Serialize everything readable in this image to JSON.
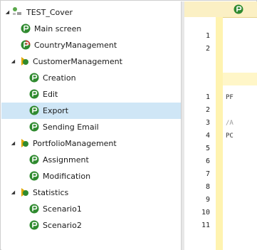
{
  "tree": {
    "root": {
      "label": "TEST_Cover",
      "icon": "test-suite-icon"
    },
    "items": [
      {
        "label": "Main screen",
        "icon": "green-test-icon"
      },
      {
        "label": "CountryManagement",
        "icon": "red-test-icon"
      },
      {
        "label": "CustomerManagement",
        "icon": "folder-test-icon"
      },
      {
        "label": "Creation",
        "icon": "green-test-icon"
      },
      {
        "label": "Edit",
        "icon": "green-test-icon"
      },
      {
        "label": "Export",
        "icon": "green-test-icon",
        "selected": true
      },
      {
        "label": "Sending Email",
        "icon": "green-test-icon"
      },
      {
        "label": "PortfolioManagement",
        "icon": "folder-test-icon"
      },
      {
        "label": "Assignment",
        "icon": "green-test-icon"
      },
      {
        "label": "Modification",
        "icon": "green-test-icon"
      },
      {
        "label": "Statistics",
        "icon": "folder-test-icon"
      },
      {
        "label": "Scenario1",
        "icon": "green-test-icon"
      },
      {
        "label": "Scenario2",
        "icon": "green-test-icon"
      }
    ]
  },
  "editor": {
    "top_lines": [
      "1",
      "2"
    ],
    "bottom_lines": [
      "1",
      "2",
      "3",
      "4",
      "5",
      "6",
      "7",
      "8",
      "9",
      "10",
      "11"
    ],
    "code": {
      "line1": "PF",
      "line3": "/A",
      "line4": "PC"
    }
  },
  "colors": {
    "selection": "#cfe6f6",
    "accent_yellow": "#fff3b0",
    "editor_header": "#fbf0c4"
  }
}
